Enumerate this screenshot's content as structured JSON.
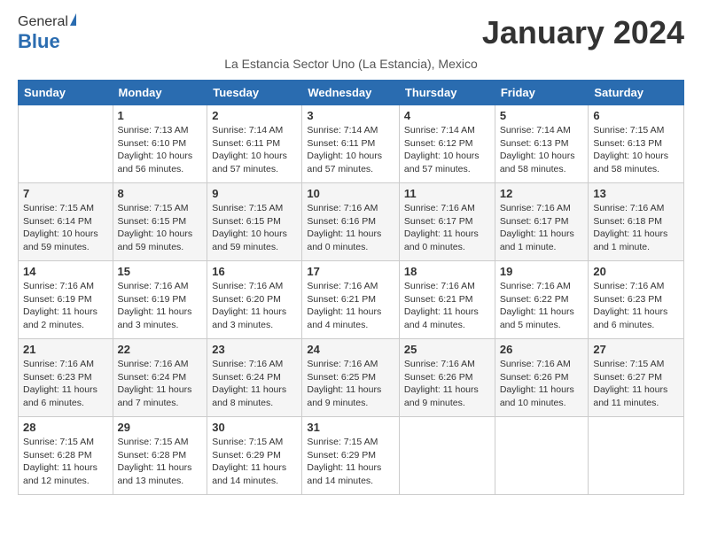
{
  "logo": {
    "general": "General",
    "blue": "Blue"
  },
  "title": "January 2024",
  "subtitle": "La Estancia Sector Uno (La Estancia), Mexico",
  "days": [
    "Sunday",
    "Monday",
    "Tuesday",
    "Wednesday",
    "Thursday",
    "Friday",
    "Saturday"
  ],
  "weeks": [
    [
      {
        "date": "",
        "info": ""
      },
      {
        "date": "1",
        "info": "Sunrise: 7:13 AM\nSunset: 6:10 PM\nDaylight: 10 hours\nand 56 minutes."
      },
      {
        "date": "2",
        "info": "Sunrise: 7:14 AM\nSunset: 6:11 PM\nDaylight: 10 hours\nand 57 minutes."
      },
      {
        "date": "3",
        "info": "Sunrise: 7:14 AM\nSunset: 6:11 PM\nDaylight: 10 hours\nand 57 minutes."
      },
      {
        "date": "4",
        "info": "Sunrise: 7:14 AM\nSunset: 6:12 PM\nDaylight: 10 hours\nand 57 minutes."
      },
      {
        "date": "5",
        "info": "Sunrise: 7:14 AM\nSunset: 6:13 PM\nDaylight: 10 hours\nand 58 minutes."
      },
      {
        "date": "6",
        "info": "Sunrise: 7:15 AM\nSunset: 6:13 PM\nDaylight: 10 hours\nand 58 minutes."
      }
    ],
    [
      {
        "date": "7",
        "info": "Sunrise: 7:15 AM\nSunset: 6:14 PM\nDaylight: 10 hours\nand 59 minutes."
      },
      {
        "date": "8",
        "info": "Sunrise: 7:15 AM\nSunset: 6:15 PM\nDaylight: 10 hours\nand 59 minutes."
      },
      {
        "date": "9",
        "info": "Sunrise: 7:15 AM\nSunset: 6:15 PM\nDaylight: 10 hours\nand 59 minutes."
      },
      {
        "date": "10",
        "info": "Sunrise: 7:16 AM\nSunset: 6:16 PM\nDaylight: 11 hours\nand 0 minutes."
      },
      {
        "date": "11",
        "info": "Sunrise: 7:16 AM\nSunset: 6:17 PM\nDaylight: 11 hours\nand 0 minutes."
      },
      {
        "date": "12",
        "info": "Sunrise: 7:16 AM\nSunset: 6:17 PM\nDaylight: 11 hours\nand 1 minute."
      },
      {
        "date": "13",
        "info": "Sunrise: 7:16 AM\nSunset: 6:18 PM\nDaylight: 11 hours\nand 1 minute."
      }
    ],
    [
      {
        "date": "14",
        "info": "Sunrise: 7:16 AM\nSunset: 6:19 PM\nDaylight: 11 hours\nand 2 minutes."
      },
      {
        "date": "15",
        "info": "Sunrise: 7:16 AM\nSunset: 6:19 PM\nDaylight: 11 hours\nand 3 minutes."
      },
      {
        "date": "16",
        "info": "Sunrise: 7:16 AM\nSunset: 6:20 PM\nDaylight: 11 hours\nand 3 minutes."
      },
      {
        "date": "17",
        "info": "Sunrise: 7:16 AM\nSunset: 6:21 PM\nDaylight: 11 hours\nand 4 minutes."
      },
      {
        "date": "18",
        "info": "Sunrise: 7:16 AM\nSunset: 6:21 PM\nDaylight: 11 hours\nand 4 minutes."
      },
      {
        "date": "19",
        "info": "Sunrise: 7:16 AM\nSunset: 6:22 PM\nDaylight: 11 hours\nand 5 minutes."
      },
      {
        "date": "20",
        "info": "Sunrise: 7:16 AM\nSunset: 6:23 PM\nDaylight: 11 hours\nand 6 minutes."
      }
    ],
    [
      {
        "date": "21",
        "info": "Sunrise: 7:16 AM\nSunset: 6:23 PM\nDaylight: 11 hours\nand 6 minutes."
      },
      {
        "date": "22",
        "info": "Sunrise: 7:16 AM\nSunset: 6:24 PM\nDaylight: 11 hours\nand 7 minutes."
      },
      {
        "date": "23",
        "info": "Sunrise: 7:16 AM\nSunset: 6:24 PM\nDaylight: 11 hours\nand 8 minutes."
      },
      {
        "date": "24",
        "info": "Sunrise: 7:16 AM\nSunset: 6:25 PM\nDaylight: 11 hours\nand 9 minutes."
      },
      {
        "date": "25",
        "info": "Sunrise: 7:16 AM\nSunset: 6:26 PM\nDaylight: 11 hours\nand 9 minutes."
      },
      {
        "date": "26",
        "info": "Sunrise: 7:16 AM\nSunset: 6:26 PM\nDaylight: 11 hours\nand 10 minutes."
      },
      {
        "date": "27",
        "info": "Sunrise: 7:15 AM\nSunset: 6:27 PM\nDaylight: 11 hours\nand 11 minutes."
      }
    ],
    [
      {
        "date": "28",
        "info": "Sunrise: 7:15 AM\nSunset: 6:28 PM\nDaylight: 11 hours\nand 12 minutes."
      },
      {
        "date": "29",
        "info": "Sunrise: 7:15 AM\nSunset: 6:28 PM\nDaylight: 11 hours\nand 13 minutes."
      },
      {
        "date": "30",
        "info": "Sunrise: 7:15 AM\nSunset: 6:29 PM\nDaylight: 11 hours\nand 14 minutes."
      },
      {
        "date": "31",
        "info": "Sunrise: 7:15 AM\nSunset: 6:29 PM\nDaylight: 11 hours\nand 14 minutes."
      },
      {
        "date": "",
        "info": ""
      },
      {
        "date": "",
        "info": ""
      },
      {
        "date": "",
        "info": ""
      }
    ]
  ]
}
